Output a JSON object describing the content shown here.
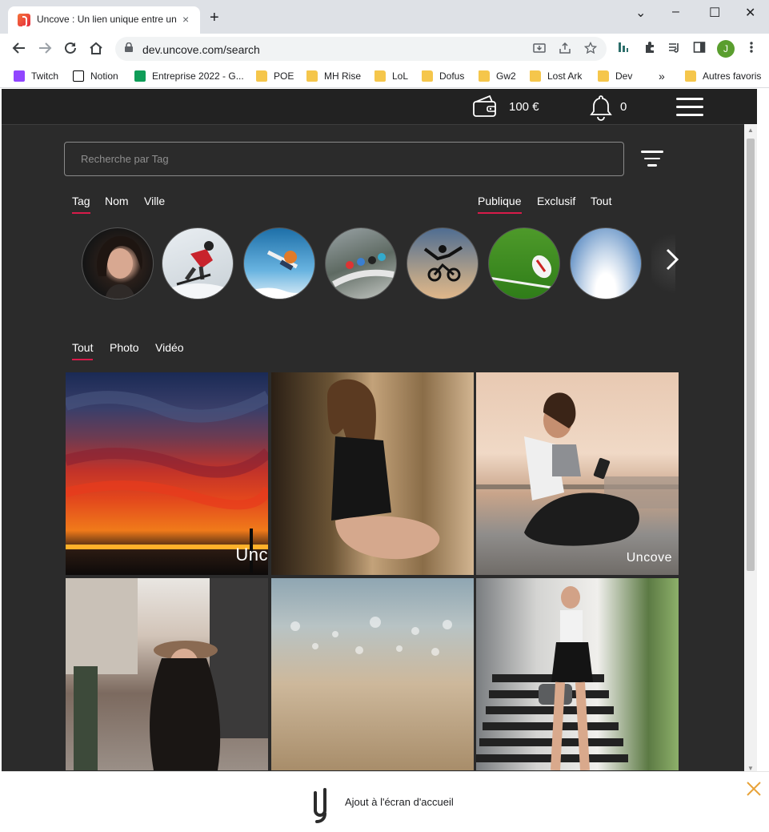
{
  "browser": {
    "tab_title": "Uncove : Un lien unique entre un",
    "tab_close": "×",
    "new_tab": "+",
    "url": "dev.uncove.com/search",
    "window_controls": [
      "⌄",
      "–",
      "☐",
      "✕"
    ],
    "profile_initial": "J",
    "bookmarks": [
      {
        "label": "Twitch",
        "icon": "twitch-icon",
        "color": "#9146ff"
      },
      {
        "label": "Notion",
        "icon": "notion-icon",
        "color": "#000000"
      },
      {
        "label": "Entreprise 2022 - G...",
        "icon": "sheets-icon",
        "color": "#0f9d58"
      },
      {
        "label": "POE",
        "icon": "folder-icon"
      },
      {
        "label": "MH Rise",
        "icon": "folder-icon"
      },
      {
        "label": "LoL",
        "icon": "folder-icon"
      },
      {
        "label": "Dofus",
        "icon": "folder-icon"
      },
      {
        "label": "Gw2",
        "icon": "folder-icon"
      },
      {
        "label": "Lost Ark",
        "icon": "folder-icon"
      },
      {
        "label": "Dev",
        "icon": "folder-icon"
      }
    ],
    "more_bookmarks": "»",
    "other_bookmarks": "Autres favoris"
  },
  "header": {
    "balance": "100 €",
    "notifications": "0"
  },
  "search": {
    "placeholder": "Recherche par Tag"
  },
  "search_mode_tabs": [
    "Tag",
    "Nom",
    "Ville"
  ],
  "visibility_tabs": [
    "Publique",
    "Exclusif",
    "Tout"
  ],
  "media_tabs": [
    "Tout",
    "Photo",
    "Vidéo"
  ],
  "stories": [
    "woman-portrait",
    "skier",
    "snowboarder",
    "cyclists",
    "motocross",
    "rugby",
    "clouds"
  ],
  "photos": [
    {
      "subject": "sunset-clouds",
      "watermark": "Unc"
    },
    {
      "subject": "woman-window",
      "watermark": ""
    },
    {
      "subject": "woman-phone-sport",
      "watermark": "Uncove"
    },
    {
      "subject": "woman-street-hat",
      "watermark": ""
    },
    {
      "subject": "beach-sand",
      "watermark": ""
    },
    {
      "subject": "woman-stairs",
      "watermark": ""
    }
  ],
  "banner": {
    "text": "Ajout à l'écran d'accueil"
  },
  "colors": {
    "page_bg": "#2b2b2b",
    "header_bg": "#222222",
    "accent": "#d81b4a",
    "banner_close": "#e8a33a"
  }
}
